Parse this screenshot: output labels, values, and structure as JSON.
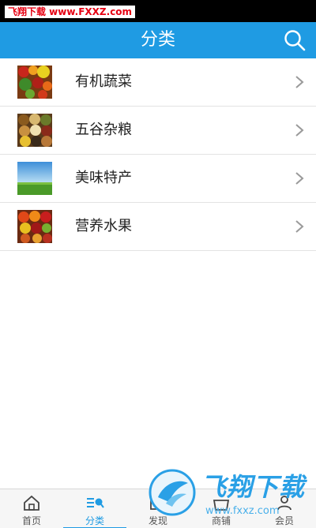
{
  "watermark_top": "飞翔下载 www.FXXZ.com",
  "header": {
    "title": "分类",
    "search_icon": "search-icon"
  },
  "categories": [
    {
      "label": "有机蔬菜",
      "thumb": "vegetables"
    },
    {
      "label": "五谷杂粮",
      "thumb": "grains"
    },
    {
      "label": "美味特产",
      "thumb": "landscape"
    },
    {
      "label": "营养水果",
      "thumb": "fruits"
    }
  ],
  "tabs": [
    {
      "label": "首页",
      "icon": "home-icon",
      "active": false
    },
    {
      "label": "分类",
      "icon": "category-icon",
      "active": true
    },
    {
      "label": "发现",
      "icon": "discover-icon",
      "active": false
    },
    {
      "label": "商铺",
      "icon": "shop-icon",
      "active": false
    },
    {
      "label": "会员",
      "icon": "member-icon",
      "active": false
    }
  ],
  "watermark_bottom": {
    "brand": "飞翔下载",
    "url": "www.fxxz.com"
  },
  "colors": {
    "accent": "#1f9be3",
    "status_bar": "#000000",
    "divider": "#e3e3e3"
  }
}
